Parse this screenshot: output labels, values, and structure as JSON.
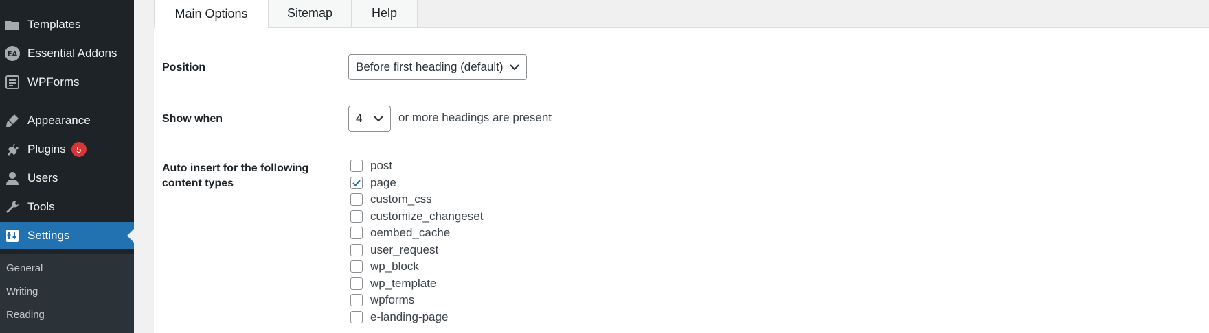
{
  "sidebar": {
    "items": [
      {
        "label": "Templates",
        "icon": "folder-icon"
      },
      {
        "label": "Essential Addons",
        "icon": "essential-addons-icon"
      },
      {
        "label": "WPForms",
        "icon": "wpforms-icon"
      },
      {
        "label": "Appearance",
        "icon": "paintbrush-icon"
      },
      {
        "label": "Plugins",
        "icon": "plugin-icon",
        "badge": "5"
      },
      {
        "label": "Users",
        "icon": "user-icon"
      },
      {
        "label": "Tools",
        "icon": "wrench-icon"
      },
      {
        "label": "Settings",
        "icon": "settings-icon",
        "active": true
      }
    ],
    "submenu": [
      "General",
      "Writing",
      "Reading"
    ]
  },
  "tabs": [
    "Main Options",
    "Sitemap",
    "Help"
  ],
  "form": {
    "position": {
      "label": "Position",
      "value": "Before first heading (default)"
    },
    "show_when": {
      "label": "Show when",
      "value": "4",
      "suffix": "or more headings are present"
    },
    "auto_insert": {
      "label_line1": "Auto insert for the following",
      "label_line2": "content types",
      "options": [
        {
          "label": "post",
          "checked": false
        },
        {
          "label": "page",
          "checked": true
        },
        {
          "label": "custom_css",
          "checked": false
        },
        {
          "label": "customize_changeset",
          "checked": false
        },
        {
          "label": "oembed_cache",
          "checked": false
        },
        {
          "label": "user_request",
          "checked": false
        },
        {
          "label": "wp_block",
          "checked": false
        },
        {
          "label": "wp_template",
          "checked": false
        },
        {
          "label": "wpforms",
          "checked": false
        },
        {
          "label": "e-landing-page",
          "checked": false
        }
      ]
    }
  },
  "colors": {
    "sidebar_bg": "#1d2327",
    "accent": "#2271b1",
    "badge": "#d63638",
    "check": "#2271b1"
  }
}
